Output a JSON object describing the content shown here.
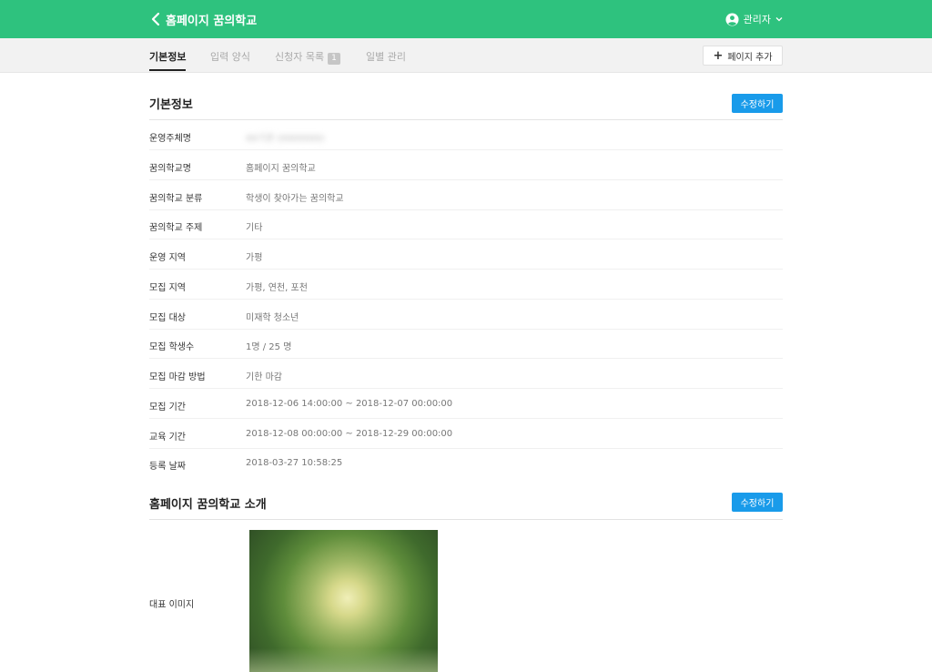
{
  "header": {
    "title": "홈페이지 꿈의학교",
    "user_label": "관리자"
  },
  "tabs": [
    {
      "label": "기본정보",
      "active": true
    },
    {
      "label": "입력 양식"
    },
    {
      "label": "신청자 목록",
      "count": "1"
    },
    {
      "label": "일별 관리"
    }
  ],
  "add_page_label": "페이지 추가",
  "basic_info": {
    "title": "기본정보",
    "edit_label": "수정하기",
    "rows": [
      {
        "label": "운영주체명",
        "value": "00기관 (0000000)"
      },
      {
        "label": "꿈의학교명",
        "value": "홈페이지 꿈의학교"
      },
      {
        "label": "꿈의학교 분류",
        "value": "학생이 찾아가는 꿈의학교"
      },
      {
        "label": "꿈의학교 주제",
        "value": "기타"
      },
      {
        "label": "운영 지역",
        "value": "가평"
      },
      {
        "label": "모집 지역",
        "value": "가평, 연천, 포천"
      },
      {
        "label": "모집 대상",
        "value": "미재학 청소년"
      },
      {
        "label": "모집 학생수",
        "value": "1명 / 25 명"
      },
      {
        "label": "모집 마감 방법",
        "value": "기한 마감"
      },
      {
        "label": "모집 기간",
        "value": "2018-12-06 14:00:00 ~ 2018-12-07 00:00:00"
      },
      {
        "label": "교육 기간",
        "value": "2018-12-08 00:00:00 ~ 2018-12-29 00:00:00"
      },
      {
        "label": "등록 날짜",
        "value": "2018-03-27 10:58:25"
      }
    ]
  },
  "intro": {
    "title": "홈페이지 꿈의학교 소개",
    "edit_label": "수정하기",
    "image_label": "대표 이미지"
  },
  "colors": {
    "brand_green": "#2ec27e",
    "edit_blue": "#199bea"
  }
}
